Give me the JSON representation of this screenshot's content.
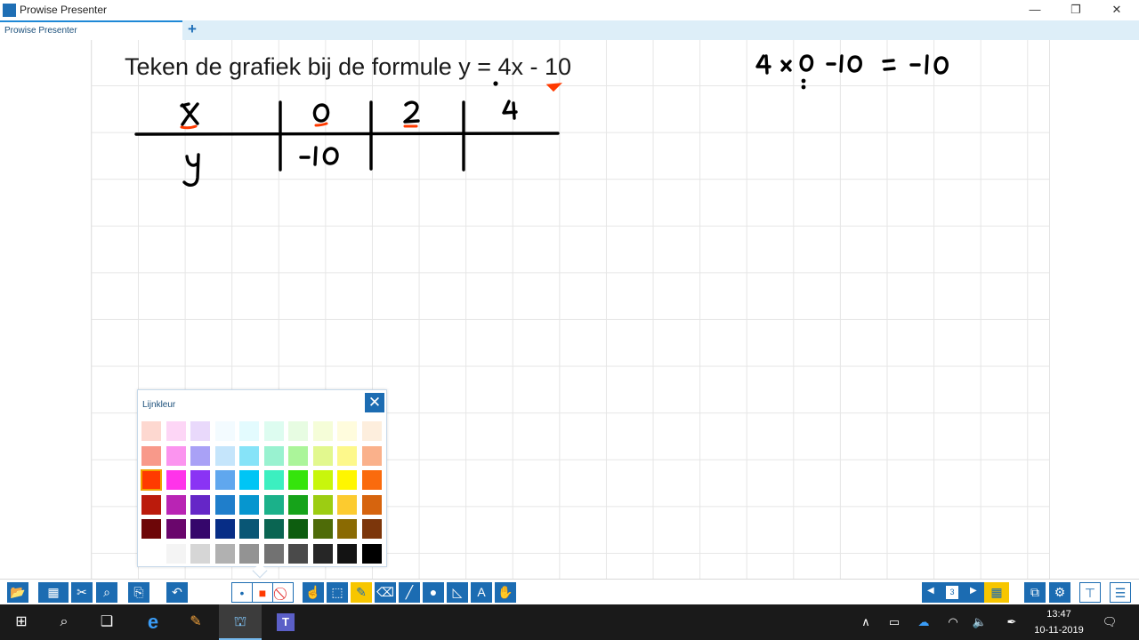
{
  "window": {
    "title": "Prowise Presenter",
    "minimize": "—",
    "restore": "❐",
    "close": "✕"
  },
  "tabs": {
    "items": [
      {
        "label": "Prowise Presenter"
      }
    ],
    "add": "+"
  },
  "board": {
    "heading": "Teken de grafiek bij de formule y = 4x - 10"
  },
  "color_panel": {
    "title": "Lijnkleur",
    "close": "✕",
    "selected": "#ff3a00",
    "swatches": [
      "#fdd8d0",
      "#fdd6f6",
      "#e9d9fb",
      "#f3fbff",
      "#e3fbfe",
      "#ddfcf0",
      "#e7fce2",
      "#f5fdd8",
      "#fffcdd",
      "#fdeedd",
      "#f8998a",
      "#fb94ef",
      "#a9a1f6",
      "#c5e5fb",
      "#86e3f8",
      "#99f2d0",
      "#abf59a",
      "#e2f88e",
      "#fdf88b",
      "#fab18b",
      "#ff3a00",
      "#ff33ea",
      "#8a33f4",
      "#60a7ee",
      "#00c5f5",
      "#3cefc0",
      "#35e40c",
      "#c8f60c",
      "#fff600",
      "#fa6b0d",
      "#bb1b0c",
      "#b924b4",
      "#6526c7",
      "#1f7ecb",
      "#0696cf",
      "#1bb18a",
      "#16a31a",
      "#9ccd12",
      "#fccb2f",
      "#d6640e",
      "#6d0608",
      "#6a066c",
      "#35066b",
      "#072d86",
      "#095675",
      "#0a6552",
      "#0d5d0f",
      "#4e6b08",
      "#8a6a02",
      "#7c360b",
      "#ffffff",
      "#f4f4f4",
      "#d6d6d6",
      "#b1b1b1",
      "#939393",
      "#727272",
      "#4a4a4a",
      "#262626",
      "#131313",
      "#000000"
    ]
  },
  "toolbar": {
    "open": "📂",
    "slides": "▦",
    "tools": "✂",
    "zoom": "⌕",
    "export": "⎘",
    "undo": "↶",
    "dot": "•",
    "fill": "■",
    "none": "⃠",
    "pointer": "☝",
    "select": "⬚",
    "pen": "✎",
    "eraser": "⌫",
    "line": "╱",
    "circle": "●",
    "ruler": "◺",
    "text": "A",
    "hand": "✋",
    "prev": "◀",
    "page": "3",
    "next": "▶",
    "grid": "▦",
    "present": "⧉",
    "settings": "⚙",
    "stand": "⊤",
    "menu": "☰"
  },
  "taskbar": {
    "start": "⊞",
    "search": "⌕",
    "taskview": "❑",
    "edge": "e",
    "paint": "✎",
    "presenter": "⛫",
    "teams": "T",
    "tray": {
      "up": "∧",
      "battery": "▭",
      "cloud": "☁",
      "wifi": "◠",
      "volume": "🔈",
      "pen": "✒",
      "notify": "🗨"
    },
    "time": "13:47",
    "date": "10-11-2019"
  }
}
